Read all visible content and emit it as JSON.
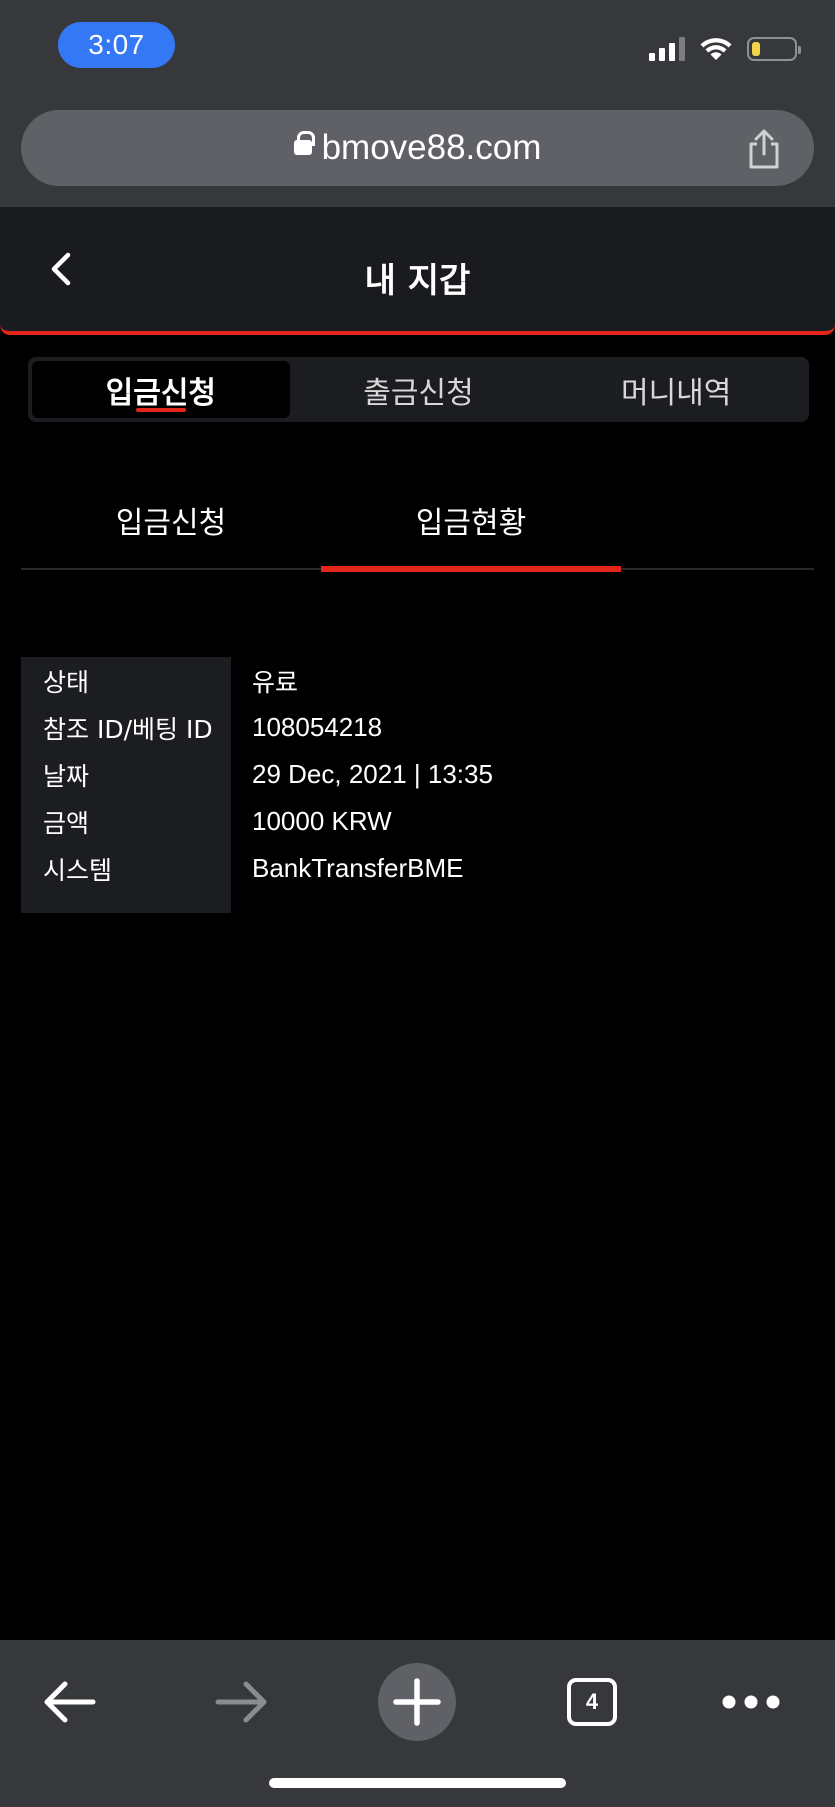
{
  "status_bar": {
    "time": "3:07"
  },
  "browser": {
    "url": "bmove88.com",
    "open_tabs_count": "4"
  },
  "header": {
    "title": "내 지갑"
  },
  "segmented_tabs": [
    {
      "label": "입금신청",
      "active": true
    },
    {
      "label": "출금신청",
      "active": false
    },
    {
      "label": "머니내역",
      "active": false
    }
  ],
  "sub_tabs": [
    {
      "label": "입금신청",
      "active": false
    },
    {
      "label": "입금현황",
      "active": true
    }
  ],
  "details": [
    {
      "label": "상태",
      "value": "유료"
    },
    {
      "label": "참조 ID/베팅 ID",
      "value": "108054218"
    },
    {
      "label": "날짜",
      "value": "29 Dec, 2021 | 13:35"
    },
    {
      "label": "금액",
      "value": "10000 KRW"
    },
    {
      "label": "시스템",
      "value": "BankTransferBME"
    }
  ],
  "icons": {
    "lock": "lock-icon",
    "share": "share-icon",
    "back": "chevron-left-icon",
    "nav_back": "arrow-left-icon",
    "nav_forward": "arrow-right-icon",
    "new_tab": "plus-icon",
    "tabs": "tabs-icon",
    "more": "more-icon"
  },
  "colors": {
    "accent": "#e3261c",
    "time_pill": "#3478f6",
    "chrome": "#36383c",
    "panel": "#1c1d20",
    "battery": "#f3d34a"
  },
  "battery_level": 0.2
}
